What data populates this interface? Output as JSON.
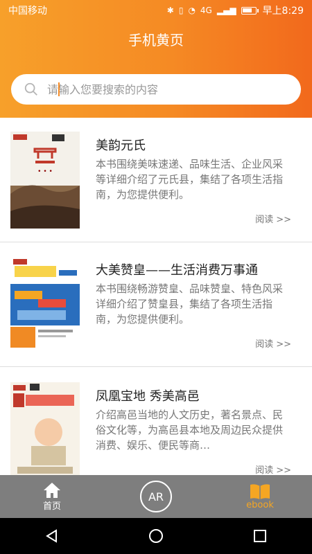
{
  "status": {
    "carrier": "中国移动",
    "network": "4G",
    "time": "早上8:29",
    "battery_level": 0.75
  },
  "header": {
    "title": "手机黄页"
  },
  "search": {
    "placeholder": "请输入您要搜索的内容",
    "icon": "search-icon"
  },
  "books": [
    {
      "title": "美韵元氏",
      "description": "本书围绕美味速递、品味生活、企业风采等详细介绍了元氏县，集结了各项生活指南，为您提供便利。",
      "read_label": "阅读 >>"
    },
    {
      "title": "大美赞皇——生活消费万事通",
      "description": "本书围绕畅游赞皇、品味赞皇、特色风采详细介绍了赞皇县，集结了各项生活指南，为您提供便利。",
      "read_label": "阅读 >>"
    },
    {
      "title": "凤凰宝地 秀美高邑",
      "description": "介绍高邑当地的人文历史，著名景点、民俗文化等，为高邑县本地及周边民众提供消费、娱乐、便民等商…",
      "read_label": "阅读 >>"
    }
  ],
  "tabs": [
    {
      "label": "首页",
      "icon": "home-icon"
    },
    {
      "label": "AR",
      "icon": "ar-icon"
    },
    {
      "label": "ebook",
      "icon": "book-icon",
      "active": true
    }
  ],
  "colors": {
    "accent": "#f58a24",
    "tab_bg": "#7e7e7e",
    "tab_active": "#f5a623"
  }
}
